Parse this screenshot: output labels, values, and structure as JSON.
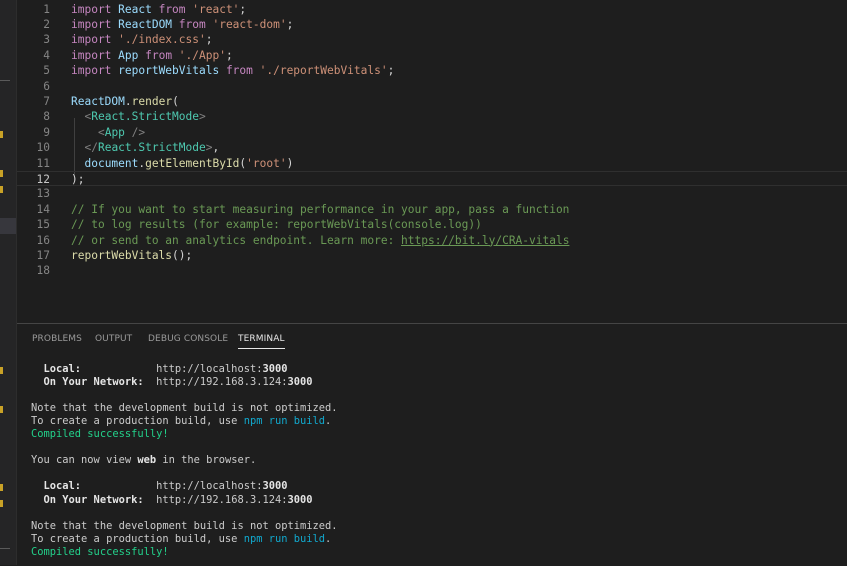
{
  "editor": {
    "current_line": 12,
    "lines": [
      {
        "n": "1",
        "t": [
          {
            "c": "kw",
            "s": "import "
          },
          {
            "c": "id",
            "s": "React"
          },
          {
            "c": "kw",
            "s": " from "
          },
          {
            "c": "str",
            "s": "'react'"
          },
          {
            "c": "pun",
            "s": ";"
          }
        ]
      },
      {
        "n": "2",
        "t": [
          {
            "c": "kw",
            "s": "import "
          },
          {
            "c": "id",
            "s": "ReactDOM"
          },
          {
            "c": "kw",
            "s": " from "
          },
          {
            "c": "str",
            "s": "'react-dom'"
          },
          {
            "c": "pun",
            "s": ";"
          }
        ]
      },
      {
        "n": "3",
        "t": [
          {
            "c": "kw",
            "s": "import "
          },
          {
            "c": "str",
            "s": "'./index.css'"
          },
          {
            "c": "pun",
            "s": ";"
          }
        ]
      },
      {
        "n": "4",
        "t": [
          {
            "c": "kw",
            "s": "import "
          },
          {
            "c": "id",
            "s": "App"
          },
          {
            "c": "kw",
            "s": " from "
          },
          {
            "c": "str",
            "s": "'./App'"
          },
          {
            "c": "pun",
            "s": ";"
          }
        ]
      },
      {
        "n": "5",
        "t": [
          {
            "c": "kw",
            "s": "import "
          },
          {
            "c": "id",
            "s": "reportWebVitals"
          },
          {
            "c": "kw",
            "s": " from "
          },
          {
            "c": "str",
            "s": "'./reportWebVitals'"
          },
          {
            "c": "pun",
            "s": ";"
          }
        ]
      },
      {
        "n": "6",
        "t": []
      },
      {
        "n": "7",
        "t": [
          {
            "c": "id",
            "s": "ReactDOM"
          },
          {
            "c": "pun",
            "s": "."
          },
          {
            "c": "fn",
            "s": "render"
          },
          {
            "c": "pun",
            "s": "("
          }
        ]
      },
      {
        "n": "8",
        "t": [
          {
            "c": "pun",
            "s": "  "
          },
          {
            "c": "tagb",
            "s": "<"
          },
          {
            "c": "comp",
            "s": "React.StrictMode"
          },
          {
            "c": "tagb",
            "s": ">"
          }
        ]
      },
      {
        "n": "9",
        "t": [
          {
            "c": "pun",
            "s": "    "
          },
          {
            "c": "tagb",
            "s": "<"
          },
          {
            "c": "comp",
            "s": "App"
          },
          {
            "c": "tagb",
            "s": " />"
          }
        ]
      },
      {
        "n": "10",
        "t": [
          {
            "c": "pun",
            "s": "  "
          },
          {
            "c": "tagb",
            "s": "</"
          },
          {
            "c": "comp",
            "s": "React.StrictMode"
          },
          {
            "c": "tagb",
            "s": ">"
          },
          {
            "c": "pun",
            "s": ","
          }
        ]
      },
      {
        "n": "11",
        "t": [
          {
            "c": "pun",
            "s": "  "
          },
          {
            "c": "id",
            "s": "document"
          },
          {
            "c": "pun",
            "s": "."
          },
          {
            "c": "fn",
            "s": "getElementById"
          },
          {
            "c": "pun",
            "s": "("
          },
          {
            "c": "str",
            "s": "'root'"
          },
          {
            "c": "pun",
            "s": ")"
          }
        ]
      },
      {
        "n": "12",
        "t": [
          {
            "c": "pun",
            "s": ");"
          }
        ]
      },
      {
        "n": "13",
        "t": []
      },
      {
        "n": "14",
        "t": [
          {
            "c": "cm",
            "s": "// If you want to start measuring performance in your app, pass a function"
          }
        ]
      },
      {
        "n": "15",
        "t": [
          {
            "c": "cm",
            "s": "// to log results (for example: reportWebVitals(console.log))"
          }
        ]
      },
      {
        "n": "16",
        "t": [
          {
            "c": "cm",
            "s": "// or send to an analytics endpoint. Learn more: "
          },
          {
            "c": "link",
            "s": "https://bit.ly/CRA-vitals"
          }
        ]
      },
      {
        "n": "17",
        "t": [
          {
            "c": "fn",
            "s": "reportWebVitals"
          },
          {
            "c": "pun",
            "s": "();"
          }
        ]
      },
      {
        "n": "18",
        "t": []
      }
    ]
  },
  "panel": {
    "tabs": [
      {
        "label": "PROBLEMS",
        "active": false
      },
      {
        "label": "OUTPUT",
        "active": false
      },
      {
        "label": "DEBUG CONSOLE",
        "active": false
      },
      {
        "label": "TERMINAL",
        "active": true
      }
    ],
    "terminal": [
      [
        {
          "c": "b",
          "s": "  Local:"
        },
        {
          "c": "",
          "s": "            http://localhost:"
        },
        {
          "c": "b",
          "s": "3000"
        }
      ],
      [
        {
          "c": "b",
          "s": "  On Your Network:"
        },
        {
          "c": "",
          "s": "  http://192.168.3.124:"
        },
        {
          "c": "b",
          "s": "3000"
        }
      ],
      [],
      [
        {
          "c": "",
          "s": "Note that the development build is not optimized."
        }
      ],
      [
        {
          "c": "",
          "s": "To create a production build, use "
        },
        {
          "c": "cy",
          "s": "npm run build"
        },
        {
          "c": "",
          "s": "."
        }
      ],
      [
        {
          "c": "gr",
          "s": "Compiled successfully!"
        }
      ],
      [],
      [
        {
          "c": "",
          "s": "You can now view "
        },
        {
          "c": "b",
          "s": "web"
        },
        {
          "c": "",
          "s": " in the browser."
        }
      ],
      [],
      [
        {
          "c": "b",
          "s": "  Local:"
        },
        {
          "c": "",
          "s": "            http://localhost:"
        },
        {
          "c": "b",
          "s": "3000"
        }
      ],
      [
        {
          "c": "b",
          "s": "  On Your Network:"
        },
        {
          "c": "",
          "s": "  http://192.168.3.124:"
        },
        {
          "c": "b",
          "s": "3000"
        }
      ],
      [],
      [
        {
          "c": "",
          "s": "Note that the development build is not optimized."
        }
      ],
      [
        {
          "c": "",
          "s": "To create a production build, use "
        },
        {
          "c": "cy",
          "s": "npm run build"
        },
        {
          "c": "",
          "s": "."
        }
      ],
      [
        {
          "c": "gr",
          "s": "Compiled successfully!"
        }
      ]
    ]
  },
  "colors": {
    "background": "#1e1e1e",
    "keyword": "#c586c0",
    "identifier": "#9cdcfe",
    "function": "#dcdcaa",
    "string": "#ce9178",
    "comment": "#6a9955",
    "component": "#4ec9b0",
    "terminal_success": "#23d18b",
    "terminal_command": "#11a8cd"
  }
}
